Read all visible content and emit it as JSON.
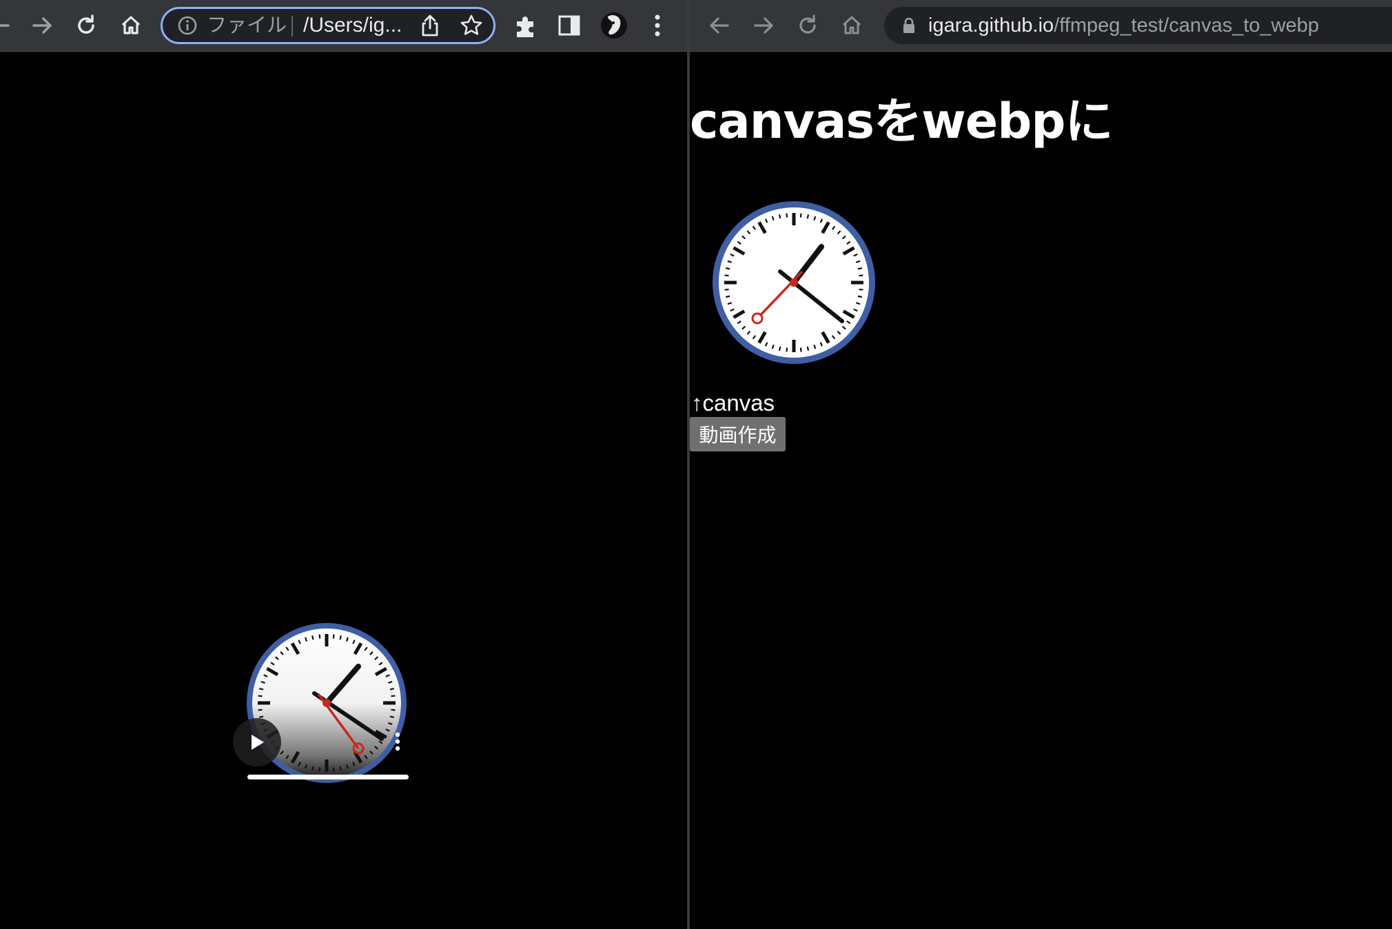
{
  "left_window": {
    "omnibox": {
      "chip_label": "ファイル",
      "url": "/Users/ig..."
    },
    "video": {
      "progress": 1.0
    }
  },
  "right_window": {
    "omnibox": {
      "host": "igara.github.io",
      "path": "/ffmpeg_test/canvas_to_webp"
    },
    "page": {
      "heading": "canvasをwebpに",
      "caption": "↑canvas",
      "button_label": "動画作成"
    }
  },
  "colors": {
    "toolbar": "#35363a",
    "omnibox": "#202124",
    "focus_ring": "#8ab4f8",
    "clock_rim": "#3f5fa4",
    "clock_second_hand": "#c8281e",
    "page_bg": "#000000"
  },
  "icons": [
    "back-icon",
    "forward-icon",
    "reload-icon",
    "home-icon",
    "info-icon",
    "share-icon",
    "star-icon",
    "extensions-icon",
    "side-panel-icon",
    "profile-avatar-icon",
    "menu-icon",
    "lock-icon",
    "play-icon",
    "more-icon"
  ]
}
